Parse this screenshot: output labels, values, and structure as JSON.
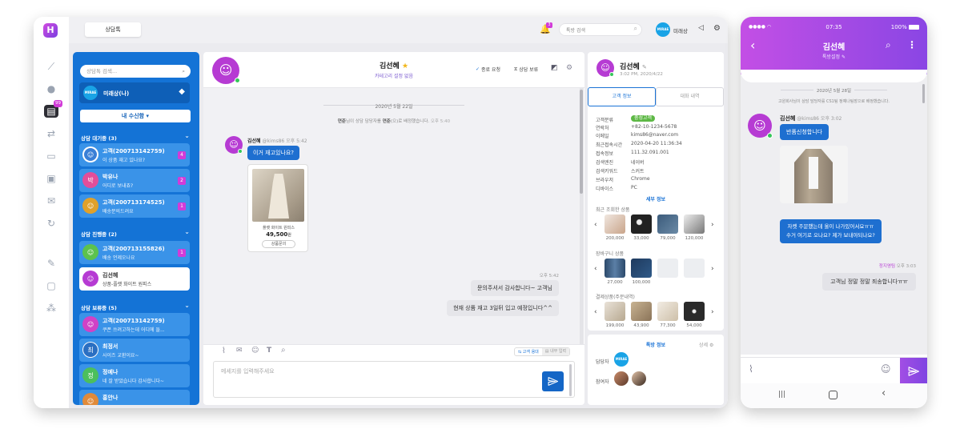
{
  "top": {
    "tab_label": "상담톡",
    "search_placeholder": "톡방 검색",
    "bell_count": "3",
    "user_name": "미래상",
    "logo_text": "MIRAE"
  },
  "rail": {
    "chat_badge": "99"
  },
  "list": {
    "search_placeholder": "상담톡 검색...",
    "me_name": "미래상(나)",
    "filter_label": "내 수신함",
    "groups": [
      {
        "title": "상담 대기중 (3)"
      },
      {
        "title": "상담 진행중 (2)"
      },
      {
        "title": "상담 보류중 (5)"
      }
    ],
    "rooms": [
      {
        "name": "고객(200713142759)",
        "msg": "이 상품 재고 있나요?",
        "badge": "4",
        "initial": "",
        "color": "#3a7fd6"
      },
      {
        "name": "박유나",
        "msg": "어디로 보내죠?",
        "badge": "2",
        "initial": "박",
        "color": "#e24e9a"
      },
      {
        "name": "고객(200713174525)",
        "msg": "배송문의드려요",
        "badge": "1",
        "initial": "",
        "color": "#e0a12a"
      },
      {
        "name": "고객(200713155826)",
        "msg": "배송 언제오나요",
        "badge": "1",
        "initial": "",
        "color": "#5cc24e"
      },
      {
        "name": "김선혜",
        "msg": "상품-플랫 화이트 원피스",
        "badge": "",
        "initial": "",
        "color": "#b63bd3"
      },
      {
        "name": "고객(200713142759)",
        "msg": "쿠폰 쓰려고하는데 어디에 들...",
        "badge": "",
        "initial": "",
        "color": "#d042c6"
      },
      {
        "name": "최정서",
        "msg": "사이즈 교환이요~",
        "badge": "",
        "initial": "최",
        "color": "#2a6fc2"
      },
      {
        "name": "정예나",
        "msg": "네 잘 받았습니다 감사합니다~",
        "badge": "",
        "initial": "정",
        "color": "#4cbf5c"
      },
      {
        "name": "홍안나",
        "msg": "",
        "badge": "",
        "initial": "",
        "color": "#e08a3a"
      }
    ]
  },
  "chat": {
    "name": "김선혜",
    "subtitle": "카테고리 설정 없음",
    "end_label": "종료 요청",
    "hold_label": "상담 보류",
    "date": "2020년 5월 22일",
    "sys_prefix": "연준",
    "sys_mid": "님이 상담 담당자를 ",
    "sys_name": "연준",
    "sys_suffix": "(으)로 배정했습니다.",
    "sys_time": "오후 5:40",
    "cust_name": "김선혜",
    "cust_handle": "@kims86",
    "cust_time": "오후 5:42",
    "cust_msg": "이거 재고있나요?",
    "product_name": "플랫 화이트 원피스",
    "product_price": "49,500",
    "product_unit": "원",
    "product_btn": "상품문의",
    "agent_time": "오후 5:42",
    "agent_msg1": "문의주셔서 감사합니다~ 고객님",
    "agent_msg2": "현재 상품 재고 3일뒤 입고 예정입니다^^",
    "toggle_customer": "고객 용대",
    "toggle_internal": "내부 입력",
    "input_placeholder": "메세지를 입력해주세요"
  },
  "info": {
    "name": "김선혜",
    "timestamp": "3:02 PM, 2020/4/22",
    "tab_customer": "고객 정보",
    "tab_history": "대화 내역",
    "rows": [
      {
        "k": "고객분류",
        "v": "충성고객"
      },
      {
        "k": "연락처",
        "v": "+82-10-1234-5678"
      },
      {
        "k": "이메일",
        "v": "kims86@naver.com"
      },
      {
        "k": "최근접속시간",
        "v": "2020-04-20 11:36:34"
      },
      {
        "k": "접속정보",
        "v": "111.32.091.001"
      },
      {
        "k": "검색엔진",
        "v": "네이버"
      },
      {
        "k": "검색키워드",
        "v": "스커트"
      },
      {
        "k": "브라우저",
        "v": "Chrome"
      },
      {
        "k": "디바이스",
        "v": "PC"
      }
    ],
    "detail_link": "세부 정보",
    "recent_title": "최근 조회한 상품",
    "recent_prices": [
      "200,000",
      "33,000",
      "79,000",
      "120,000"
    ],
    "cart_title": "장바구니 상품",
    "cart_prices": [
      "27,000",
      "100,000"
    ],
    "paid_title": "결제상품(주문내역)",
    "paid_prices": [
      "199,000",
      "43,900",
      "77,300",
      "54,000"
    ],
    "room_title": "톡방 정보",
    "room_detail": "상세",
    "manager_label": "담당자",
    "participant_label": "참여자"
  },
  "mobile": {
    "carrier": "●●●● ",
    "time": "07:35",
    "battery": "100%",
    "title": "김선혜",
    "subtitle": "톡방설정",
    "date": "2020년 5월 28일",
    "sys": "고원회사님이 상담 담당자를 CS1팀 정예나팀장으로 배정했습니다.",
    "cust_name": "김선혜",
    "cust_handle": "@kims86",
    "cust_time": "오후 3:02",
    "msg1": "반품신청합니다",
    "msg2_line1": "자켓 주문했는데 올이 나가있어서요ㅠㅠ",
    "msg2_line2": "수거 여기로 오나요? 제가 보내야되나요?",
    "agent_name": "정지영팀",
    "agent_time": "오후 3:03",
    "agent_msg": "고객님 정말 정말 죄송합니다ㅠㅠ"
  }
}
